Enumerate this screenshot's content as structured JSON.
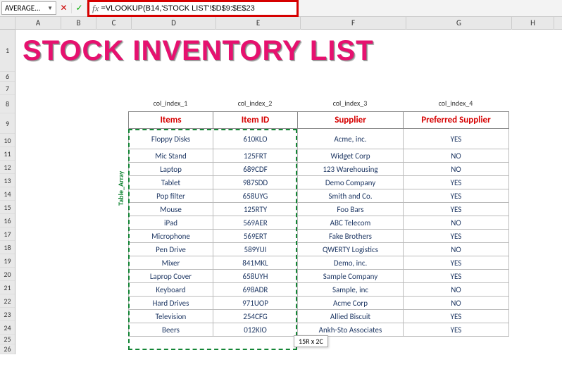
{
  "formula_bar": {
    "name_box": "AVERAGE...",
    "fx_label": "fx",
    "formula": "=VLOOKUP(B14,'STOCK LIST'!$D$9:$E$23"
  },
  "columns": [
    "",
    "A",
    "B",
    "C",
    "D",
    "E",
    "F",
    "G",
    "H"
  ],
  "row_numbers": [
    "1",
    "6",
    "7",
    "8",
    "9",
    "10",
    "11",
    "12",
    "13",
    "14",
    "15",
    "16",
    "17",
    "18",
    "19",
    "20",
    "21",
    "22",
    "23",
    "24",
    "25",
    "26"
  ],
  "title": "STOCK INVENTORY LIST",
  "index_labels": [
    "col_index_1",
    "col_index_2",
    "col_index_3",
    "col_index_4"
  ],
  "headers": [
    "Items",
    "Item ID",
    "Supplier",
    "Preferred Supplier"
  ],
  "rows": [
    {
      "item": "Floppy Disks",
      "id": "610KLO",
      "supplier": "Acme, inc.",
      "pref": "YES"
    },
    {
      "item": "Mic Stand",
      "id": "125FRT",
      "supplier": "Widget Corp",
      "pref": "NO"
    },
    {
      "item": "Laptop",
      "id": "689CDF",
      "supplier": "123 Warehousing",
      "pref": "NO"
    },
    {
      "item": "Tablet",
      "id": "987SDD",
      "supplier": "Demo Company",
      "pref": "YES"
    },
    {
      "item": "Pop filter",
      "id": "658UYG",
      "supplier": "Smith and Co.",
      "pref": "YES"
    },
    {
      "item": "Mouse",
      "id": "125RTY",
      "supplier": "Foo Bars",
      "pref": "YES"
    },
    {
      "item": "iPad",
      "id": "569AER",
      "supplier": "ABC Telecom",
      "pref": "NO"
    },
    {
      "item": "Microphone",
      "id": "569ERT",
      "supplier": "Fake Brothers",
      "pref": "YES"
    },
    {
      "item": "Pen Drive",
      "id": "589YUI",
      "supplier": "QWERTY Logistics",
      "pref": "NO"
    },
    {
      "item": "Mixer",
      "id": "841MKL",
      "supplier": "Demo, inc.",
      "pref": "YES"
    },
    {
      "item": "Laprop Cover",
      "id": "658UYH",
      "supplier": "Sample Company",
      "pref": "YES"
    },
    {
      "item": "Keyboard",
      "id": "698ADR",
      "supplier": "Sample, inc",
      "pref": "NO"
    },
    {
      "item": "Hard Drives",
      "id": "971UOP",
      "supplier": "Acme Corp",
      "pref": "NO"
    },
    {
      "item": "Television",
      "id": "254CFG",
      "supplier": "Allied Biscuit",
      "pref": "YES"
    },
    {
      "item": "Beers",
      "id": "012KIO",
      "supplier": "Ankh-Sto Associates",
      "pref": "YES"
    }
  ],
  "side_label": "Table_Array",
  "selection_badge": "15R x 2C"
}
